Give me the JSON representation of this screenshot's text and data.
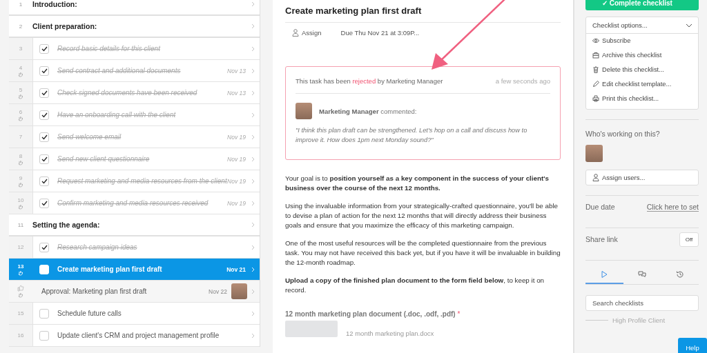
{
  "checklist": [
    {
      "kind": "heading",
      "number": "1",
      "title": "Introduction:"
    },
    {
      "kind": "heading",
      "number": "2",
      "title": "Client preparation:"
    },
    {
      "kind": "task",
      "number": "3",
      "title": "Record basic details for this client",
      "checked": true,
      "assigned": false
    },
    {
      "kind": "task",
      "number": "4",
      "title": "Send contract and additional documents",
      "date": "Nov 13",
      "checked": true,
      "assigned": true
    },
    {
      "kind": "task",
      "number": "5",
      "title": "Check signed documents have been received",
      "date": "Nov 13",
      "checked": true,
      "assigned": true
    },
    {
      "kind": "task",
      "number": "6",
      "title": "Have an onboarding call with the client",
      "checked": true,
      "assigned": true
    },
    {
      "kind": "task",
      "number": "7",
      "title": "Send welcome email",
      "date": "Nov 19",
      "checked": true,
      "assigned": false
    },
    {
      "kind": "task",
      "number": "8",
      "title": "Send new client questionnaire",
      "date": "Nov 19",
      "checked": true,
      "assigned": true
    },
    {
      "kind": "task",
      "number": "9",
      "title": "Request marketing and media resources from the client",
      "date": "Nov 19",
      "checked": true,
      "assigned": true
    },
    {
      "kind": "task",
      "number": "10",
      "title": "Confirm marketing and media resources received",
      "date": "Nov 19",
      "checked": true,
      "assigned": true
    },
    {
      "kind": "heading",
      "number": "11",
      "title": "Setting the agenda:"
    },
    {
      "kind": "task",
      "number": "12",
      "title": "Research campaign ideas",
      "checked": true,
      "assigned": false
    },
    {
      "kind": "task",
      "number": "13",
      "title": "Create marketing plan first draft",
      "date": "Nov 21",
      "checked": false,
      "assigned": true,
      "selected": true
    },
    {
      "kind": "approval",
      "title": "Approval: Marketing plan first draft",
      "date": "Nov 22",
      "assigned": true
    },
    {
      "kind": "task",
      "number": "15",
      "title": "Schedule future calls",
      "checked": false,
      "assigned": false
    },
    {
      "kind": "task",
      "number": "16",
      "title": "Update client's CRM and project management profile",
      "checked": false,
      "assigned": false
    }
  ],
  "task": {
    "title": "Create marketing plan first draft",
    "assign": "Assign",
    "due": "Due Thu Nov 21 at 3:09P...",
    "notice": {
      "before": "This task has been",
      "status": "rejected",
      "after": "by Marketing Manager",
      "time": "a few seconds ago"
    },
    "comment": {
      "author": "Marketing Manager",
      "action": "commented:",
      "text": "\"I think this plan draft can be strengthened. Let's hop on a call and discuss how to improve it. How does 1pm next Monday sound?\""
    },
    "paragraphs": [
      "Your goal is to **position yourself as a key component in the success of your client's business over the course of the next 12 months.**",
      "Using the invaluable information from your strategically-crafted questionnaire, you'll be able to devise a plan of action for the next 12 months that will directly address their business goals and ensure that you maximize the efficacy of this marketing campaign.",
      "One of the most useful resources will be the completed questionnaire from the previous task. You may not have received this back yet, but if you have it will be invaluable in building the 12-month roadmap.",
      "**Upload a copy of the finished plan document to the form field below**, to keep it on record."
    ],
    "upload": {
      "label": "12 month marketing plan document (.doc, .odf, .pdf)",
      "required": "*",
      "file": "12 month marketing plan.docx"
    }
  },
  "sidebar": {
    "complete": "✓ Complete checklist",
    "options": {
      "title": "Checklist options...",
      "items": [
        {
          "label": "Subscribe"
        },
        {
          "label": "Archive this checklist"
        },
        {
          "label": "Delete this checklist..."
        },
        {
          "label": "Edit checklist template..."
        },
        {
          "label": "Print this checklist..."
        }
      ]
    },
    "working": "Who's working on this?",
    "assign_users": "Assign users...",
    "due_label": "Due date",
    "due_link": "Click here to set",
    "share_label": "Share link",
    "share": {
      "on": false,
      "label": "Off"
    },
    "tabs": [
      {
        "selected": true
      },
      {
        "selected": false
      },
      {
        "selected": false
      }
    ],
    "search": {
      "placeholder": "Search checklists"
    },
    "list_item": "High Profile Client",
    "help": "Help"
  }
}
